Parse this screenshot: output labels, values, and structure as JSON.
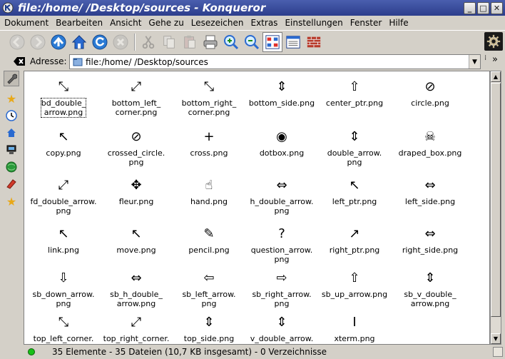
{
  "window": {
    "title": "file:/home/      /Desktop/sources - Konqueror"
  },
  "menubar": {
    "items": [
      "Dokument",
      "Bearbeiten",
      "Ansicht",
      "Gehe zu",
      "Lesezeichen",
      "Extras",
      "Einstellungen",
      "Fenster",
      "Hilfe"
    ]
  },
  "toolbar": {
    "icons": [
      "back-icon",
      "forward-icon",
      "up-icon",
      "home-icon",
      "reload-icon",
      "stop-icon",
      "cut-icon",
      "copy-icon",
      "paste-icon",
      "print-icon",
      "zoom-in-icon",
      "zoom-out-icon",
      "icon-view-icon",
      "detail-view-icon",
      "firewall-icon",
      "konqueror-gear-icon"
    ]
  },
  "location": {
    "label": "Adresse:",
    "value": "file:/home/        /Desktop/sources"
  },
  "files": [
    {
      "name": "bd_double_\narrow.png",
      "glyph": "⤡",
      "selected": true
    },
    {
      "name": "bottom_left_\ncorner.png",
      "glyph": "⤢"
    },
    {
      "name": "bottom_right_\ncorner.png",
      "glyph": "⤡"
    },
    {
      "name": "bottom_side.png",
      "glyph": "⇕"
    },
    {
      "name": "center_ptr.png",
      "glyph": "⇧"
    },
    {
      "name": "circle.png",
      "glyph": "⊘"
    },
    {
      "name": "copy.png",
      "glyph": "↖"
    },
    {
      "name": "crossed_circle.\npng",
      "glyph": "⊘"
    },
    {
      "name": "cross.png",
      "glyph": "+"
    },
    {
      "name": "dotbox.png",
      "glyph": "◉"
    },
    {
      "name": "double_arrow.\npng",
      "glyph": "⇕"
    },
    {
      "name": "draped_box.png",
      "glyph": "☠"
    },
    {
      "name": "fd_double_arrow.\npng",
      "glyph": "⤢"
    },
    {
      "name": "fleur.png",
      "glyph": "✥"
    },
    {
      "name": "hand.png",
      "glyph": "☝"
    },
    {
      "name": "h_double_arrow.\npng",
      "glyph": "⇔"
    },
    {
      "name": "left_ptr.png",
      "glyph": "↖"
    },
    {
      "name": "left_side.png",
      "glyph": "⇔"
    },
    {
      "name": "link.png",
      "glyph": "↖"
    },
    {
      "name": "move.png",
      "glyph": "↖"
    },
    {
      "name": "pencil.png",
      "glyph": "✎"
    },
    {
      "name": "question_arrow.\npng",
      "glyph": "?"
    },
    {
      "name": "right_ptr.png",
      "glyph": "↗"
    },
    {
      "name": "right_side.png",
      "glyph": "⇔"
    },
    {
      "name": "sb_down_arrow.\npng",
      "glyph": "⇩"
    },
    {
      "name": "sb_h_double_\narrow.png",
      "glyph": "⇔"
    },
    {
      "name": "sb_left_arrow.\npng",
      "glyph": "⇦"
    },
    {
      "name": "sb_right_arrow.\npng",
      "glyph": "⇨"
    },
    {
      "name": "sb_up_arrow.png",
      "glyph": "⇧"
    },
    {
      "name": "sb_v_double_\narrow.png",
      "glyph": "⇕"
    },
    {
      "name": "top_left_corner.",
      "glyph": "⤡"
    },
    {
      "name": "top_right_corner.",
      "glyph": "⤢"
    },
    {
      "name": "top_side.png",
      "glyph": "⇕"
    },
    {
      "name": "v_double_arrow.",
      "glyph": "⇕"
    },
    {
      "name": "xterm.png",
      "glyph": "I"
    }
  ],
  "status": {
    "text": "35 Elemente - 35 Dateien (10,7 KB insgesamt) - 0 Verzeichnisse"
  },
  "colors": {
    "titlebar": "#2c3d8c",
    "accent": "#1e78d0",
    "status_led": "#18c018"
  }
}
